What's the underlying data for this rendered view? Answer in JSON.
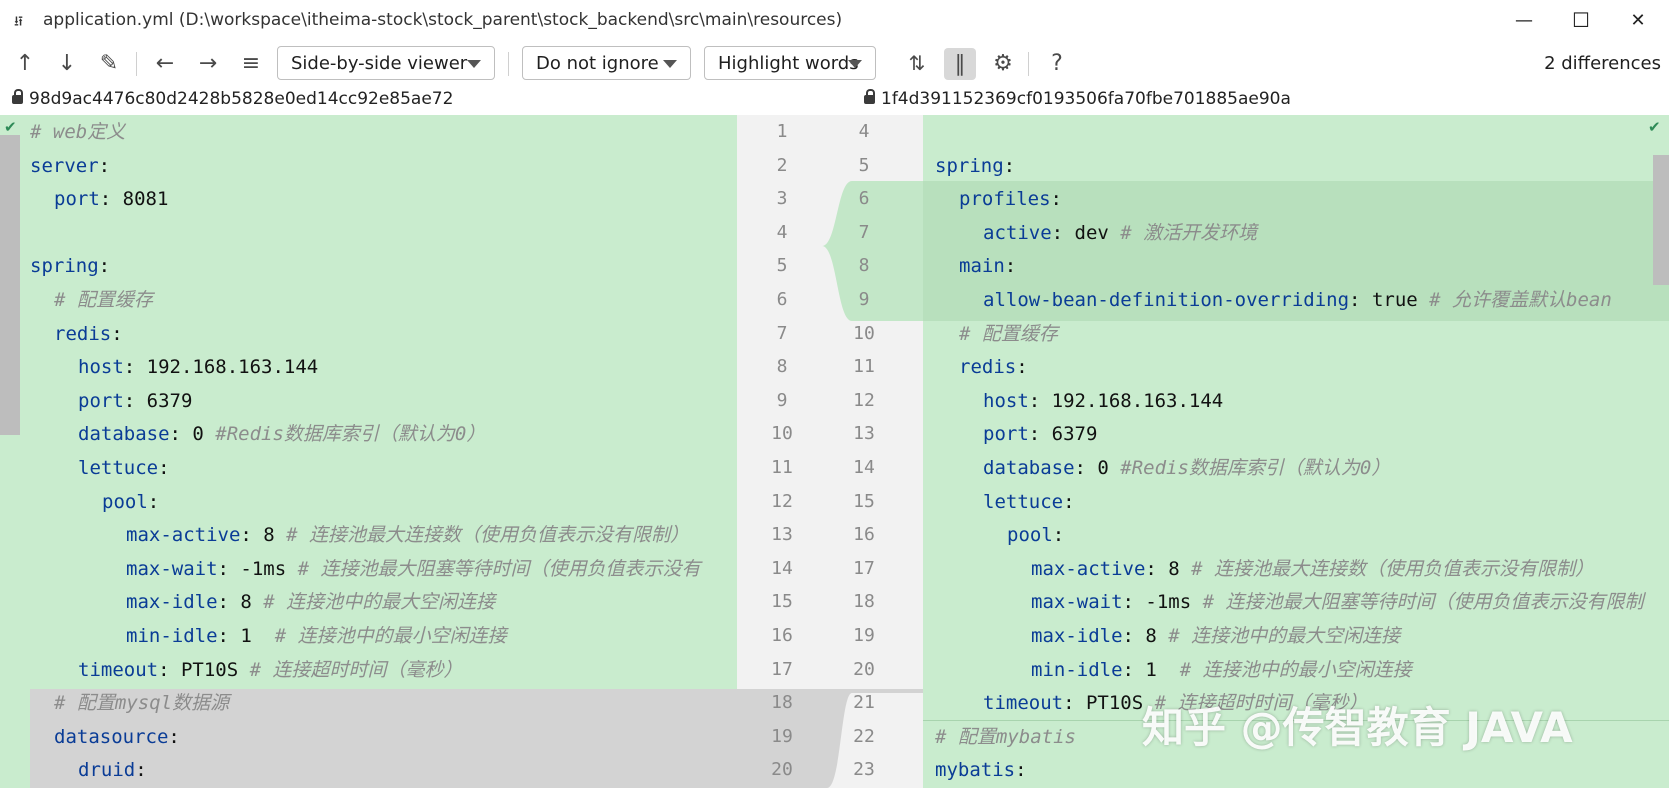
{
  "window": {
    "title": "application.yml (D:\\workspace\\itheima-stock\\stock_parent\\stock_backend\\src\\main\\resources)",
    "controls": {
      "minimize": "—",
      "maximize": "☐",
      "close": "✕"
    }
  },
  "toolbar": {
    "icons": [
      "arrow-up-icon",
      "arrow-down-icon",
      "edit-icon",
      "arrow-left-icon",
      "arrow-right-icon",
      "list-icon",
      "collapse-icon",
      "sync-scroll-icon",
      "settings-icon",
      "help-icon"
    ],
    "viewer_mode": "Side-by-side viewer",
    "ignore_mode": "Do not ignore",
    "highlight_mode": "Highlight words",
    "help": "?",
    "differences": "2 differences"
  },
  "left": {
    "revision": "98d9ac4476c80d2428b5828e0ed14cc92e85ae72",
    "lines": [
      {
        "n": "1",
        "key": "",
        "val": "",
        "comment": "# web定义",
        "indent": 0
      },
      {
        "n": "2",
        "key": "server",
        "val": "",
        "comment": "",
        "indent": 0
      },
      {
        "n": "3",
        "key": "port",
        "val": " 8081",
        "comment": "",
        "indent": 1
      },
      {
        "n": "4",
        "key": "",
        "val": "",
        "comment": "",
        "indent": 0
      },
      {
        "n": "5",
        "key": "spring",
        "val": "",
        "comment": "",
        "indent": 0
      },
      {
        "n": "6",
        "key": "",
        "val": "",
        "comment": "# 配置缓存",
        "indent": 1
      },
      {
        "n": "7",
        "key": "redis",
        "val": "",
        "comment": "",
        "indent": 1
      },
      {
        "n": "8",
        "key": "host",
        "val": " 192.168.163.144",
        "comment": "",
        "indent": 2
      },
      {
        "n": "9",
        "key": "port",
        "val": " 6379",
        "comment": "",
        "indent": 2
      },
      {
        "n": "10",
        "key": "database",
        "val": " 0 ",
        "comment": "#Redis数据库索引（默认为0）",
        "indent": 2
      },
      {
        "n": "11",
        "key": "lettuce",
        "val": "",
        "comment": "",
        "indent": 2
      },
      {
        "n": "12",
        "key": "pool",
        "val": "",
        "comment": "",
        "indent": 3
      },
      {
        "n": "13",
        "key": "max-active",
        "val": " 8 ",
        "comment": "# 连接池最大连接数（使用负值表示没有限制）",
        "indent": 4
      },
      {
        "n": "14",
        "key": "max-wait",
        "val": " -1ms ",
        "comment": "# 连接池最大阻塞等待时间（使用负值表示没有",
        "indent": 4
      },
      {
        "n": "15",
        "key": "max-idle",
        "val": " 8 ",
        "comment": "# 连接池中的最大空闲连接",
        "indent": 4
      },
      {
        "n": "16",
        "key": "min-idle",
        "val": " 1  ",
        "comment": "# 连接池中的最小空闲连接",
        "indent": 4
      },
      {
        "n": "17",
        "key": "timeout",
        "val": " PT10S ",
        "comment": "# 连接超时时间（毫秒）",
        "indent": 2
      },
      {
        "n": "18",
        "key": "",
        "val": "",
        "comment": "# 配置mysql数据源",
        "indent": 1
      },
      {
        "n": "19",
        "key": "datasource",
        "val": "",
        "comment": "",
        "indent": 1
      },
      {
        "n": "20",
        "key": "druid",
        "val": "",
        "comment": "",
        "indent": 2
      }
    ]
  },
  "right": {
    "revision": "1f4d391152369cf0193506fa70fbe701885ae90a",
    "lines": [
      {
        "n": "4",
        "key": "",
        "val": "",
        "comment": "",
        "indent": 0
      },
      {
        "n": "5",
        "key": "spring",
        "val": "",
        "comment": "",
        "indent": 0
      },
      {
        "n": "6",
        "key": "profiles",
        "val": "",
        "comment": "",
        "indent": 1
      },
      {
        "n": "7",
        "key": "active",
        "val": " dev ",
        "comment": "# 激活开发环境",
        "indent": 2
      },
      {
        "n": "8",
        "key": "main",
        "val": "",
        "comment": "",
        "indent": 1
      },
      {
        "n": "9",
        "key": "allow-bean-definition-overriding",
        "val": " true ",
        "comment": "# 允许覆盖默认bean",
        "indent": 2
      },
      {
        "n": "10",
        "key": "",
        "val": "",
        "comment": "# 配置缓存",
        "indent": 1
      },
      {
        "n": "11",
        "key": "redis",
        "val": "",
        "comment": "",
        "indent": 1
      },
      {
        "n": "12",
        "key": "host",
        "val": " 192.168.163.144",
        "comment": "",
        "indent": 2
      },
      {
        "n": "13",
        "key": "port",
        "val": " 6379",
        "comment": "",
        "indent": 2
      },
      {
        "n": "14",
        "key": "database",
        "val": " 0 ",
        "comment": "#Redis数据库索引（默认为0）",
        "indent": 2
      },
      {
        "n": "15",
        "key": "lettuce",
        "val": "",
        "comment": "",
        "indent": 2
      },
      {
        "n": "16",
        "key": "pool",
        "val": "",
        "comment": "",
        "indent": 3
      },
      {
        "n": "17",
        "key": "max-active",
        "val": " 8 ",
        "comment": "# 连接池最大连接数（使用负值表示没有限制）",
        "indent": 4
      },
      {
        "n": "18",
        "key": "max-wait",
        "val": " -1ms ",
        "comment": "# 连接池最大阻塞等待时间（使用负值表示没有限制",
        "indent": 4
      },
      {
        "n": "19",
        "key": "max-idle",
        "val": " 8 ",
        "comment": "# 连接池中的最大空闲连接",
        "indent": 4
      },
      {
        "n": "20",
        "key": "min-idle",
        "val": " 1  ",
        "comment": "# 连接池中的最小空闲连接",
        "indent": 4
      },
      {
        "n": "21",
        "key": "timeout",
        "val": " PT10S ",
        "comment": "# 连接超时时间（毫秒）",
        "indent": 2
      },
      {
        "n": "22",
        "key": "",
        "val": "",
        "comment": "# 配置mybatis",
        "indent": 0
      },
      {
        "n": "23",
        "key": "mybatis",
        "val": "",
        "comment": "",
        "indent": 0
      }
    ]
  },
  "watermark": "知乎 @传智教育 JAVA",
  "colors": {
    "added_bg": "#c9ecce",
    "changed_bg": "#b5dfbb",
    "removed_bg": "#d3d3d3",
    "key": "#0a3c96",
    "comment": "#8c8c8c"
  }
}
